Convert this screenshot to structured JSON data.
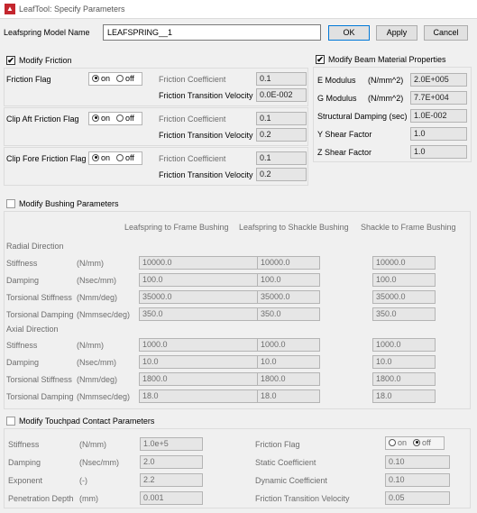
{
  "window": {
    "title": "LeafTool: Specify Parameters",
    "icon": "app-logo-icon"
  },
  "top": {
    "model_name_label": "Leafspring Model Name",
    "model_name_value": "LEAFSPRING__1",
    "ok_label": "OK",
    "apply_label": "Apply",
    "cancel_label": "Cancel"
  },
  "friction": {
    "checkbox_label": "Modify Friction",
    "checked": true,
    "rows": [
      {
        "flag_label": "Friction Flag",
        "on_label": "on",
        "off_label": "off",
        "selected": "on",
        "coef_label": "Friction Coefficient",
        "coef_value": "0.1",
        "vel_label": "Friction Transition Velocity",
        "vel_value": "0.0E-002"
      },
      {
        "flag_label": "Clip Aft Friction Flag",
        "on_label": "on",
        "off_label": "off",
        "selected": "on",
        "coef_label": "Friction Coefficient",
        "coef_value": "0.1",
        "vel_label": "Friction Transition Velocity",
        "vel_value": "0.2"
      },
      {
        "flag_label": "Clip Fore Friction Flag",
        "on_label": "on",
        "off_label": "off",
        "selected": "on",
        "coef_label": "Friction Coefficient",
        "coef_value": "0.1",
        "vel_label": "Friction Transition Velocity",
        "vel_value": "0.2"
      }
    ]
  },
  "beam": {
    "checkbox_label": "Modify Beam Material Properties",
    "checked": true,
    "rows": [
      {
        "label": "E Modulus",
        "unit": "(N/mm^2)",
        "value": "2.0E+005"
      },
      {
        "label": "G Modulus",
        "unit": "(N/mm^2)",
        "value": "7.7E+004"
      },
      {
        "label": "Structural Damping (sec)",
        "unit": "",
        "value": "1.0E-002"
      },
      {
        "label": "Y Shear Factor",
        "unit": "",
        "value": "1.0"
      },
      {
        "label": "Z Shear Factor",
        "unit": "",
        "value": "1.0"
      }
    ]
  },
  "bushing": {
    "checkbox_label": "Modify Bushing Parameters",
    "checked": false,
    "col_headers": [
      "Leafspring to Frame Bushing",
      "Leafspring to Shackle Bushing",
      "Shackle to Frame Bushing"
    ],
    "radial": {
      "title": "Radial Direction",
      "rows": [
        {
          "label": "Stiffness",
          "unit": "(N/mm)",
          "values": [
            "10000.0",
            "10000.0",
            "10000.0"
          ]
        },
        {
          "label": "Damping",
          "unit": "(Nsec/mm)",
          "values": [
            "100.0",
            "100.0",
            "100.0"
          ]
        },
        {
          "label": "Torsional Stiffness",
          "unit": "(Nmm/deg)",
          "values": [
            "35000.0",
            "35000.0",
            "35000.0"
          ]
        },
        {
          "label": "Torsional Damping",
          "unit": "(Nmmsec/deg)",
          "values": [
            "350.0",
            "350.0",
            "350.0"
          ]
        }
      ]
    },
    "axial": {
      "title": "Axial Direction",
      "rows": [
        {
          "label": "Stiffness",
          "unit": "(N/mm)",
          "values": [
            "1000.0",
            "1000.0",
            "1000.0"
          ]
        },
        {
          "label": "Damping",
          "unit": "(Nsec/mm)",
          "values": [
            "10.0",
            "10.0",
            "10.0"
          ]
        },
        {
          "label": "Torsional Stiffness",
          "unit": "(Nmm/deg)",
          "values": [
            "1800.0",
            "1800.0",
            "1800.0"
          ]
        },
        {
          "label": "Torsional Damping",
          "unit": "(Nmmsec/deg)",
          "values": [
            "18.0",
            "18.0",
            "18.0"
          ]
        }
      ]
    }
  },
  "touchpad": {
    "checkbox_label": "Modify Touchpad Contact Parameters",
    "checked": false,
    "left": [
      {
        "label": "Stiffness",
        "unit": "(N/mm)",
        "value": "1.0e+5"
      },
      {
        "label": "Damping",
        "unit": "(Nsec/mm)",
        "value": "2.0"
      },
      {
        "label": "Exponent",
        "unit": "(-)",
        "value": "2.2"
      },
      {
        "label": "Penetration Depth",
        "unit": "(mm)",
        "value": "0.001"
      }
    ],
    "flag": {
      "label": "Friction Flag",
      "on_label": "on",
      "off_label": "off",
      "selected": "off"
    },
    "right": [
      {
        "label": "Static Coefficient",
        "value": "0.10"
      },
      {
        "label": "Dynamic Coefficient",
        "value": "0.10"
      },
      {
        "label": "Friction Transition Velocity",
        "value": "0.05"
      }
    ]
  }
}
